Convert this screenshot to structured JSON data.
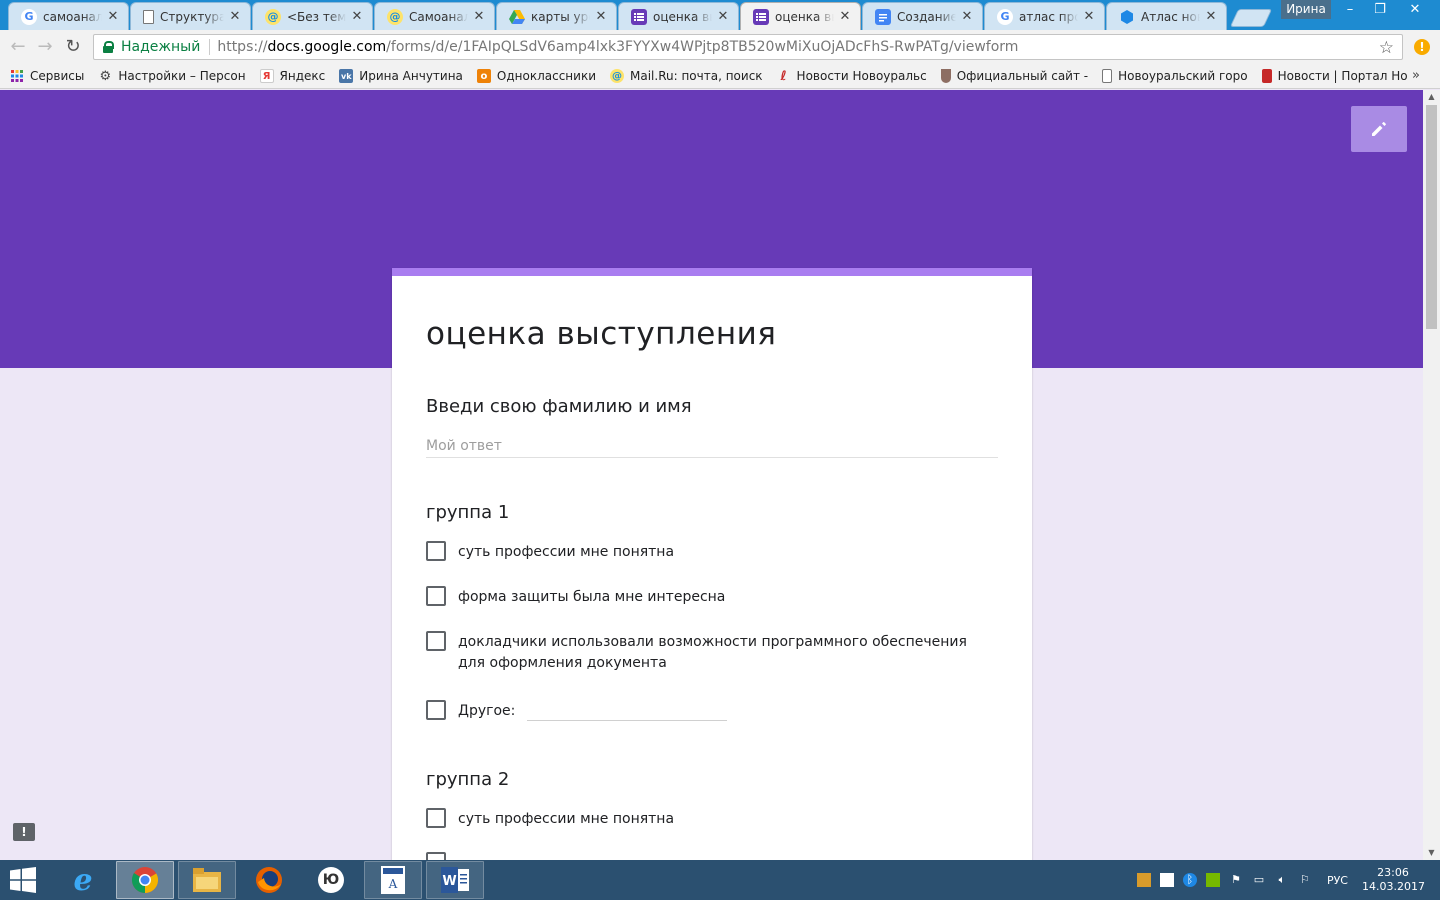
{
  "browser": {
    "tabs": [
      {
        "title": "самоанализ",
        "icon": "google-icon",
        "active": false
      },
      {
        "title": "Структура урока",
        "icon": "document-icon",
        "active": false
      },
      {
        "title": "<Без темы>",
        "icon": "mailru-icon",
        "active": false
      },
      {
        "title": "Самоанализ",
        "icon": "mailru-icon",
        "active": false
      },
      {
        "title": "карты урока",
        "icon": "google-drive-icon",
        "active": false
      },
      {
        "title": "оценка выступления",
        "icon": "google-forms-icon",
        "active": false
      },
      {
        "title": "оценка выступления",
        "icon": "google-forms-icon",
        "active": true
      },
      {
        "title": "Создание теста",
        "icon": "google-docs-icon",
        "active": false
      },
      {
        "title": "атлас профессий",
        "icon": "google-icon",
        "active": false
      },
      {
        "title": "Атлас новых профессий",
        "icon": "atlas-icon",
        "active": false
      }
    ],
    "profile_name": "Ирина",
    "address": {
      "security_label": "Надежный",
      "scheme": "https://",
      "host": "docs.google.com",
      "path": "/forms/d/e/1FAIpQLSdV6amp4lxk3FYYXw4WPjtp8TB520wMiXuOjADcFhS-RwPATg/viewform"
    },
    "bookmarks": [
      {
        "label": "Сервисы",
        "icon": "apps-grid-icon"
      },
      {
        "label": "Настройки – Персон",
        "icon": "gear-icon"
      },
      {
        "label": "Яндекс",
        "icon": "yandex-icon"
      },
      {
        "label": "Ирина Анчутина",
        "icon": "vk-icon"
      },
      {
        "label": "Одноклассники",
        "icon": "odnoklassniki-icon"
      },
      {
        "label": "Mail.Ru: почта, поиск",
        "icon": "mailru-icon"
      },
      {
        "label": "Новости Новоуральс",
        "icon": "news-icon"
      },
      {
        "label": "Официальный сайт -",
        "icon": "coat-of-arms-icon"
      },
      {
        "label": "Новоуральский горо",
        "icon": "page-icon"
      },
      {
        "label": "Новости | Портал Но",
        "icon": "portal-icon"
      }
    ],
    "bookmarks_more": "»"
  },
  "form": {
    "title": "оценка выступления",
    "q1": {
      "title": "Введи свою фамилию и имя",
      "placeholder": "Мой ответ"
    },
    "group1": {
      "title": "группа 1",
      "options": [
        "суть профессии мне понятна",
        "форма защиты была мне интересна",
        "докладчики использовали возможности программного обеспечения для оформления документа"
      ],
      "other_label": "Другое:"
    },
    "group2": {
      "title": "группа 2",
      "options": [
        "суть профессии мне понятна"
      ]
    },
    "colors": {
      "banner": "#673ab7",
      "accent": "#a97df0",
      "background": "#ede7f6"
    }
  },
  "taskbar": {
    "apps": [
      "internet-explorer-icon",
      "chrome-icon",
      "file-explorer-icon",
      "firefox-icon",
      "yandex-browser-icon",
      "word-document-icon",
      "word-icon"
    ],
    "language": "РУС",
    "time": "23:06",
    "date": "14.03.2017"
  }
}
